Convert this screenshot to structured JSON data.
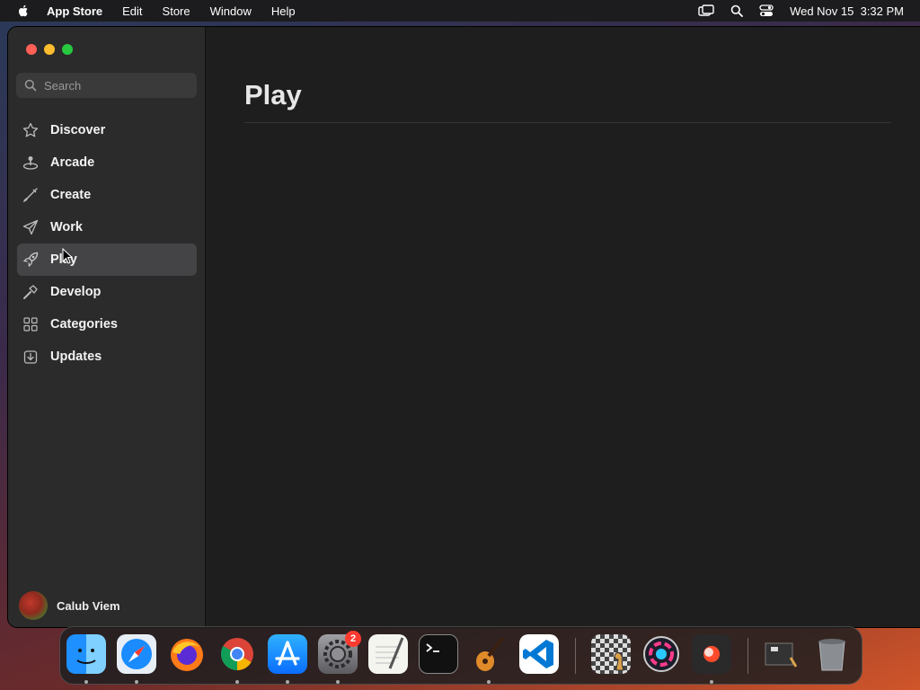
{
  "menubar": {
    "app_name": "App Store",
    "items": [
      "Edit",
      "Store",
      "Window",
      "Help"
    ],
    "datetime": "Wed Nov 15  3:32 PM"
  },
  "search": {
    "placeholder": "Search"
  },
  "sidebar": {
    "items": [
      {
        "label": "Discover",
        "icon": "star-icon"
      },
      {
        "label": "Arcade",
        "icon": "joystick-icon"
      },
      {
        "label": "Create",
        "icon": "brush-icon"
      },
      {
        "label": "Work",
        "icon": "paperplane-icon"
      },
      {
        "label": "Play",
        "icon": "rocket-icon",
        "selected": true
      },
      {
        "label": "Develop",
        "icon": "hammer-icon"
      },
      {
        "label": "Categories",
        "icon": "grid-icon"
      },
      {
        "label": "Updates",
        "icon": "download-icon"
      }
    ]
  },
  "user": {
    "name": "Calub Viem"
  },
  "main": {
    "title": "Play"
  },
  "dock": {
    "apps": [
      "finder-icon",
      "safari-icon",
      "firefox-icon",
      "chrome-icon",
      "app-store-icon",
      "system-settings-icon",
      "textedit-icon",
      "terminal-icon",
      "garageband-icon",
      "vscode-icon",
      "chess-icon",
      "pixelmator-icon",
      "screen-recorder-icon",
      "downloads-stack-icon",
      "trash-icon"
    ],
    "settings_badge": "2"
  },
  "colors": {
    "selected_row": "#444446",
    "window_bg": "#1e1e1e",
    "sidebar_bg": "#2b2b2b"
  }
}
